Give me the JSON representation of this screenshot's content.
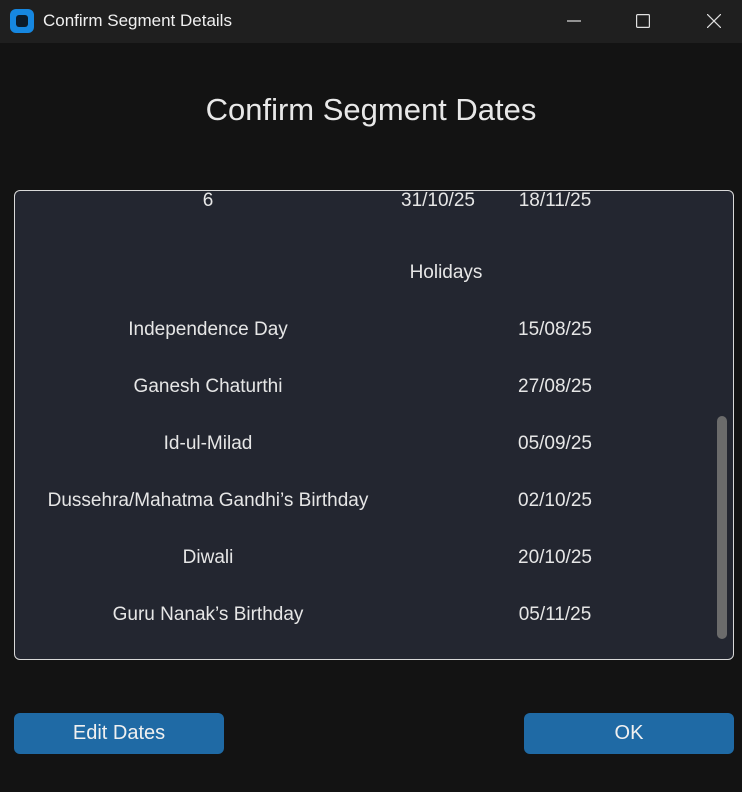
{
  "window": {
    "title": "Confirm Segment Details",
    "app_icon": "app-icon",
    "controls": {
      "minimize": "minimize-icon",
      "maximize": "maximize-icon",
      "close": "close-icon"
    }
  },
  "heading": "Confirm Segment Dates",
  "segments_partial_row": {
    "segment": "6",
    "start": "31/10/25",
    "end": "18/11/25"
  },
  "holidays_heading": "Holidays",
  "holidays": [
    {
      "name": "Independence Day",
      "date": "15/08/25"
    },
    {
      "name": "Ganesh Chaturthi",
      "date": "27/08/25"
    },
    {
      "name": "Id-ul-Milad",
      "date": "05/09/25"
    },
    {
      "name": "Dussehra/Mahatma Gandhi’s Birthday",
      "date": "02/10/25"
    },
    {
      "name": "Diwali",
      "date": "20/10/25"
    },
    {
      "name": "Guru Nanak’s Birthday",
      "date": "05/11/25"
    }
  ],
  "buttons": {
    "edit": "Edit Dates",
    "ok": "OK"
  },
  "colors": {
    "accent": "#1f6aa5",
    "panel": "#232630",
    "background": "#131313",
    "titlebar": "#1f1f1f"
  }
}
